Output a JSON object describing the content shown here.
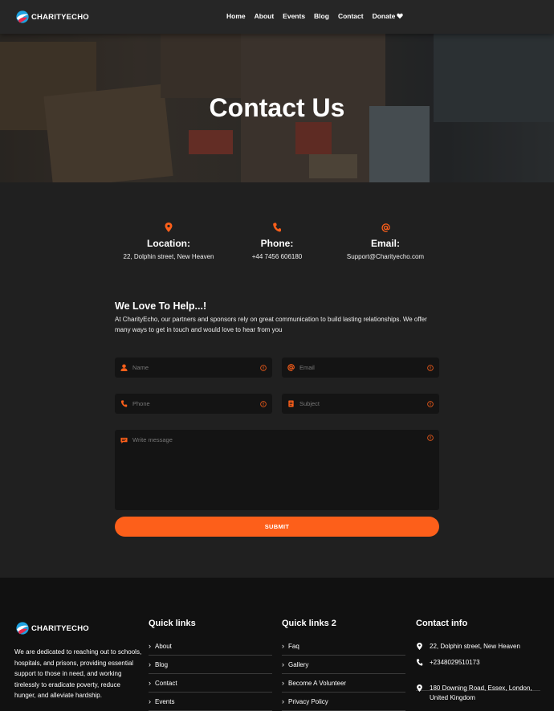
{
  "brand": {
    "name": "CHARITYECHO"
  },
  "nav": {
    "items": [
      "Home",
      "About",
      "Events",
      "Blog",
      "Contact",
      "Donate"
    ]
  },
  "hero": {
    "title": "Contact Us"
  },
  "info": [
    {
      "icon": "location-pin-icon",
      "label": "Location:",
      "value": "22, Dolphin street, New Heaven"
    },
    {
      "icon": "phone-icon",
      "label": "Phone:",
      "value": "+44 7456 606180"
    },
    {
      "icon": "at-sign-icon",
      "label": "Email:",
      "value": "Support@Charityecho.com"
    }
  ],
  "help": {
    "title": "We Love To Help...!",
    "text": "At CharityEcho, our partners and sponsors rely on great communication to build lasting relationships. We offer many ways to get in touch and would love to hear from you"
  },
  "form": {
    "name_placeholder": "Name",
    "email_placeholder": "Email",
    "phone_placeholder": "Phone",
    "subject_placeholder": "Subject",
    "message_placeholder": "Write message",
    "submit_label": "SUBMIT"
  },
  "footer": {
    "about": "We are dedicated to reaching out to schools, hospitals, and prisons, providing essential support to those in need, and working tirelessly to eradicate poverty, reduce hunger, and alleviate hardship.",
    "quick_links_title": "Quick links",
    "quick_links": [
      "About",
      "Blog",
      "Contact",
      "Events"
    ],
    "quick_links2_title": "Quick links 2",
    "quick_links2": [
      "Faq",
      "Gallery",
      "Become A Volunteer",
      "Privacy Policy"
    ],
    "contact_title": "Contact info",
    "contact": {
      "address1": "22, Dolphin street, New Heaven",
      "phone": "+2348029510173",
      "address2": "180 Downing Road, Essex, London, United Kingdom"
    }
  },
  "colors": {
    "accent": "#fd5f1a",
    "background": "#202020",
    "nav": "#262626",
    "footer": "#111111",
    "field": "#141414"
  }
}
